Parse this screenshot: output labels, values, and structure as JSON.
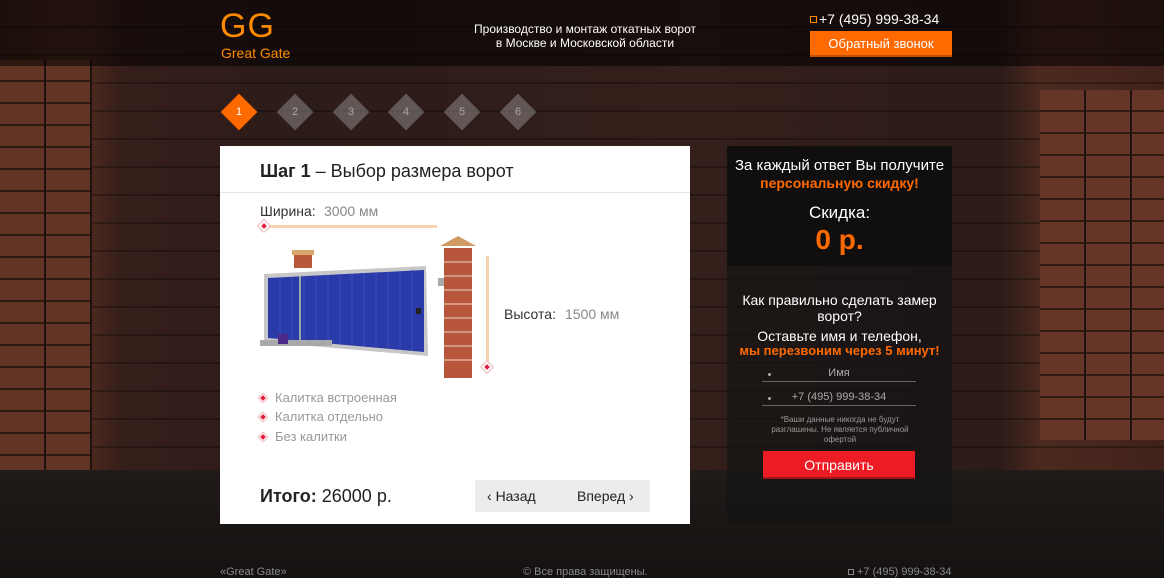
{
  "header": {
    "logo_mark": "GG",
    "logo_text": "Great Gate",
    "tagline_line1": "Производство и монтаж откатных ворот",
    "tagline_line2": "в Москве и Московской области",
    "phone": "+7 (495) 999-38-34",
    "callback_label": "Обратный звонок"
  },
  "steps": [
    "1",
    "2",
    "3",
    "4",
    "5",
    "6"
  ],
  "active_step": 1,
  "card": {
    "title_bold": "Шаг 1",
    "title_rest": " – Выбор размера ворот",
    "width_label": "Ширина:",
    "width_value": "3000 мм",
    "height_label": "Высота:",
    "height_value": "1500 мм",
    "options": [
      "Калитка встроенная",
      "Калитка отдельно",
      "Без калитки"
    ],
    "total_label": "Итого:",
    "total_value": " 26000 р.",
    "back_label": "Назад",
    "next_label": "Вперед"
  },
  "side": {
    "promo_line1": "За каждый ответ Вы получите",
    "promo_line2": "персональную скидку!",
    "discount_label": "Скидка:",
    "discount_value": "0 р.",
    "question": "Как правильно сделать замер ворот?",
    "cta_line1": "Оставьте имя и телефон,",
    "cta_line2": "мы перезвоним через 5 минут!",
    "name_placeholder": "Имя",
    "phone_placeholder": "+7 (495) 999-38-34",
    "disclaimer": "*Ваши данные никогда не будут разглашены. Не является публичной офертой",
    "submit_label": "Отправить"
  },
  "footer": {
    "brand": "«Great Gate»",
    "copyright": "© Все права защищены.",
    "phone": "+7 (495) 999-38-34"
  },
  "colors": {
    "accent": "#ff6a00",
    "submit": "#ed1c24",
    "gate_blue": "#2a3aa8"
  }
}
